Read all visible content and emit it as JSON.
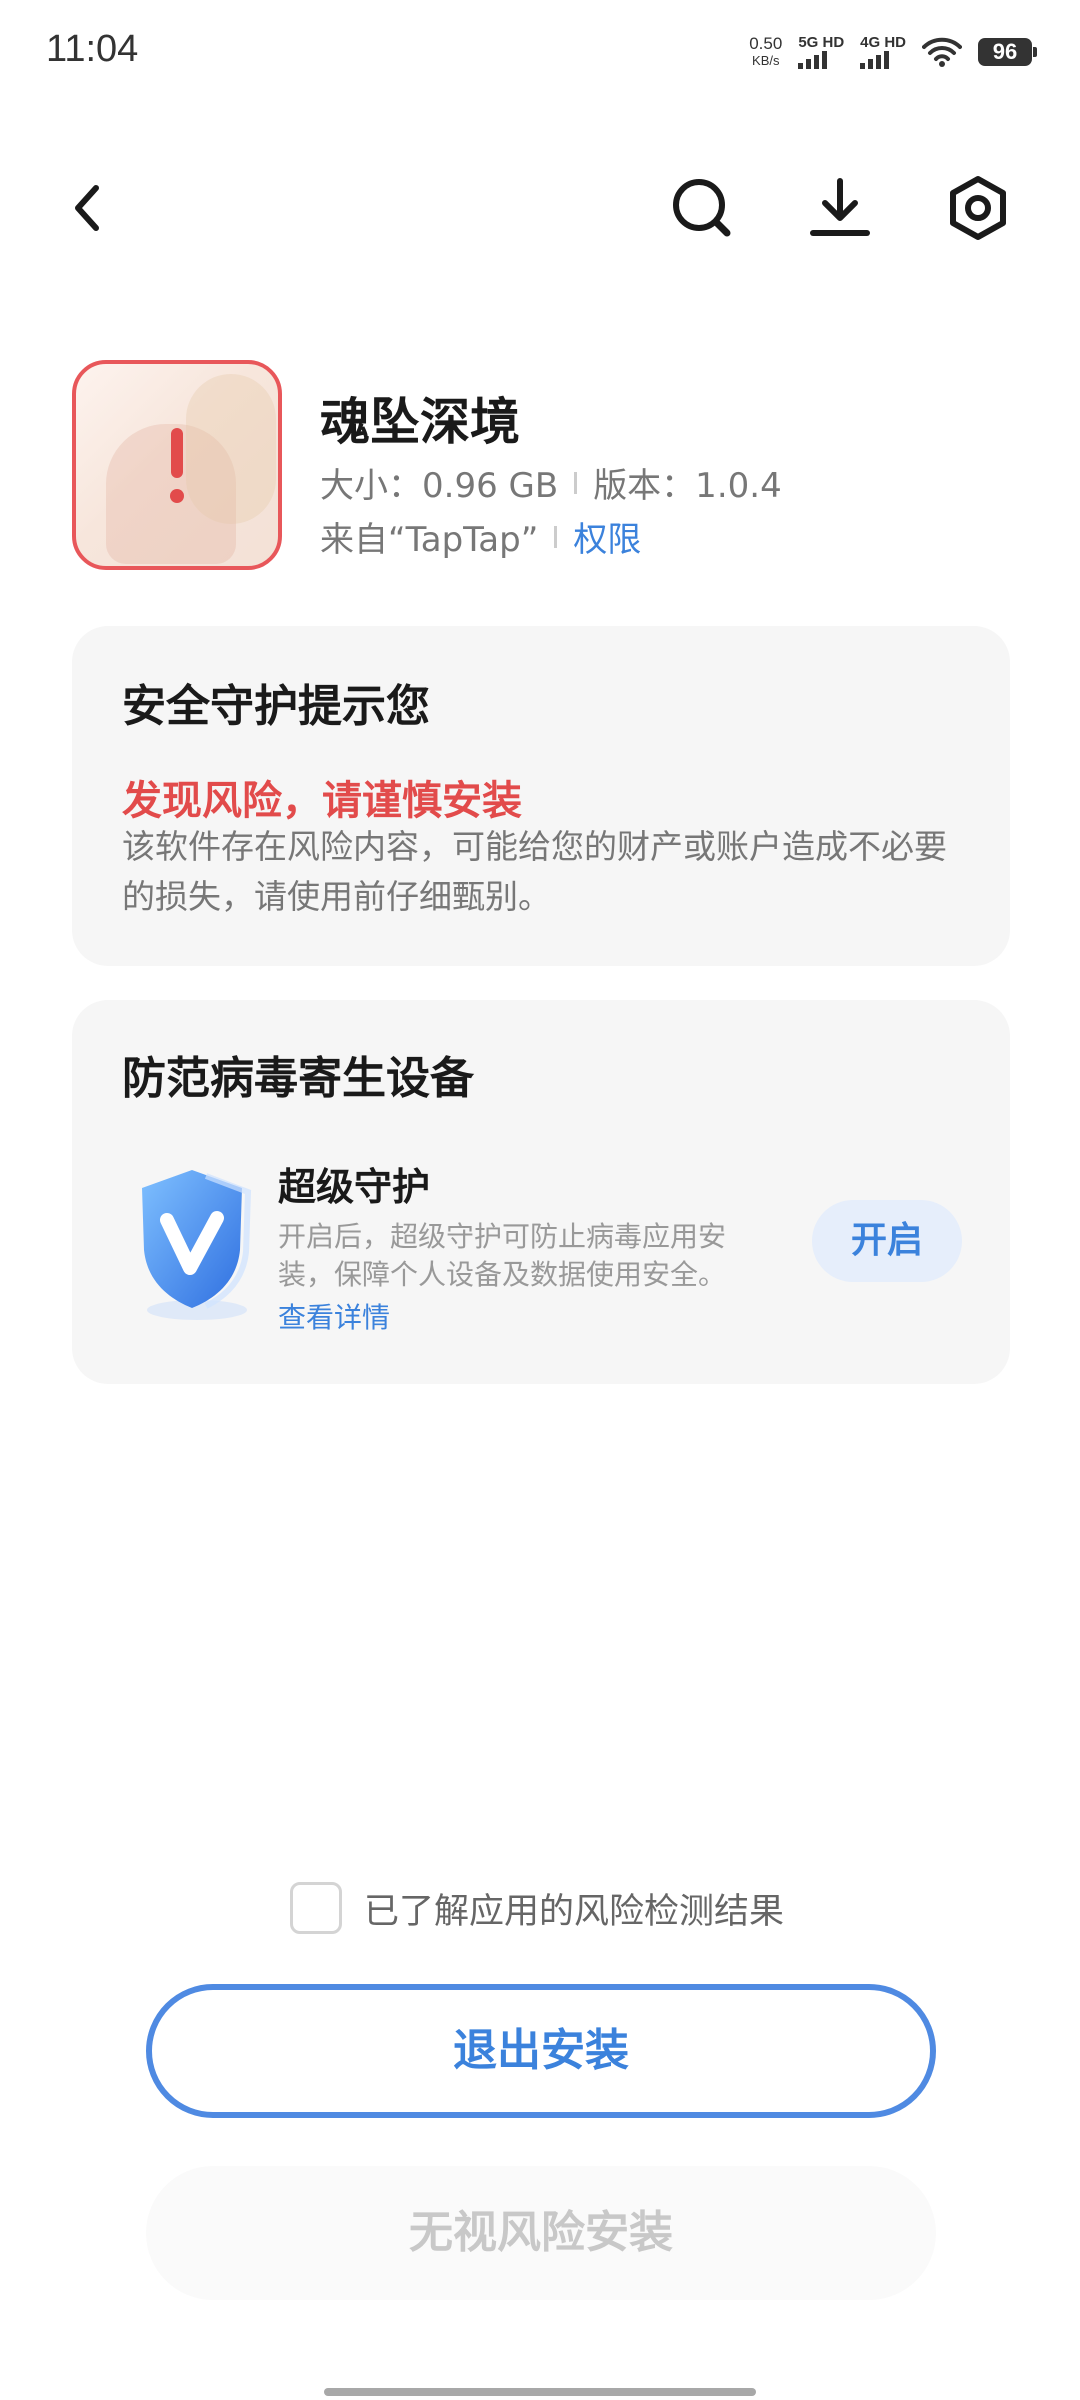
{
  "status_bar": {
    "time": "11:04",
    "net_speed": "0.50",
    "net_unit": "KB/s",
    "signal1": "5G HD",
    "signal2": "4G HD",
    "battery": "96"
  },
  "topbar": {
    "back_icon": "back-arrow-icon",
    "search_icon": "search-icon",
    "download_icon": "download-icon",
    "settings_icon": "settings-hex-icon"
  },
  "app": {
    "name": "魂坠深境",
    "size": "大小：0.96 GB",
    "version": "版本：1.0.4",
    "source": "来自“TapTap”",
    "permission_link": "权限",
    "icon_alert": "!"
  },
  "security_card": {
    "title": "安全守护提示您",
    "risk_title": "发现风险，请谨慎安装",
    "risk_desc": "该软件存在风险内容，可能给您的财产或账户造成不必要的损失，请使用前仔细甄别。"
  },
  "protection_card": {
    "title": "防范病毒寄生设备",
    "feature_title": "超级守护",
    "feature_desc": "开启后，超级守护可防止病毒应用安装，保障个人设备及数据使用安全。",
    "more_link": "查看详情",
    "enable_button": "开启"
  },
  "bottom": {
    "ack_text": "已了解应用的风险检测结果",
    "ack_checked": false,
    "exit_button": "退出安装",
    "ignore_button": "无视风险安装"
  },
  "colors": {
    "accent": "#3b82dc",
    "danger": "#e24b4b",
    "card_bg": "#f6f6f6"
  }
}
